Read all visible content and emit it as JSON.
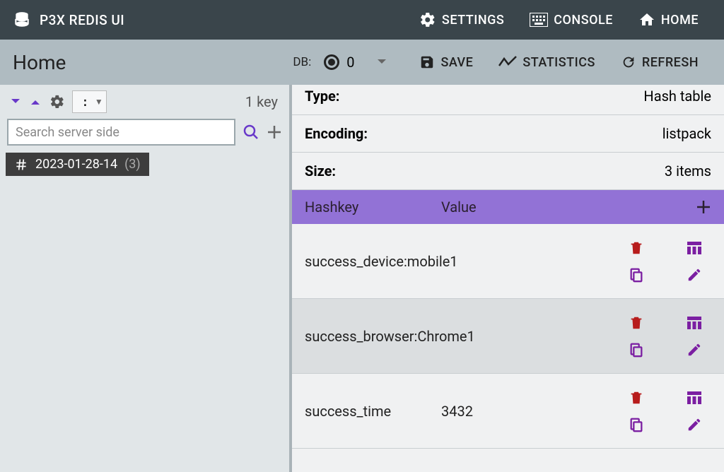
{
  "header": {
    "brand": "P3X REDIS UI",
    "settings": "SETTINGS",
    "console": "CONSOLE",
    "home": "HOME"
  },
  "toolbar": {
    "home_label": "Home",
    "db_label": "DB:",
    "db_value": "0",
    "save": "SAVE",
    "statistics": "STATISTICS",
    "refresh": "REFRESH"
  },
  "sidebar": {
    "separator": ":",
    "keycount": "1 key",
    "search_placeholder": "Search server side",
    "tree_key": "2023-01-28-14",
    "tree_count": "(3)"
  },
  "info": {
    "type_label": "Type:",
    "type_value": "Hash table",
    "encoding_label": "Encoding:",
    "encoding_value": "listpack",
    "size_label": "Size:",
    "size_value": "3  items"
  },
  "table": {
    "col_hashkey": "Hashkey",
    "col_value": "Value",
    "rows": [
      {
        "key": "success_device:mobile1",
        "value": ""
      },
      {
        "key": "success_browser:Chrome1",
        "value": ""
      },
      {
        "key": "success_time",
        "value": "3432"
      }
    ]
  }
}
